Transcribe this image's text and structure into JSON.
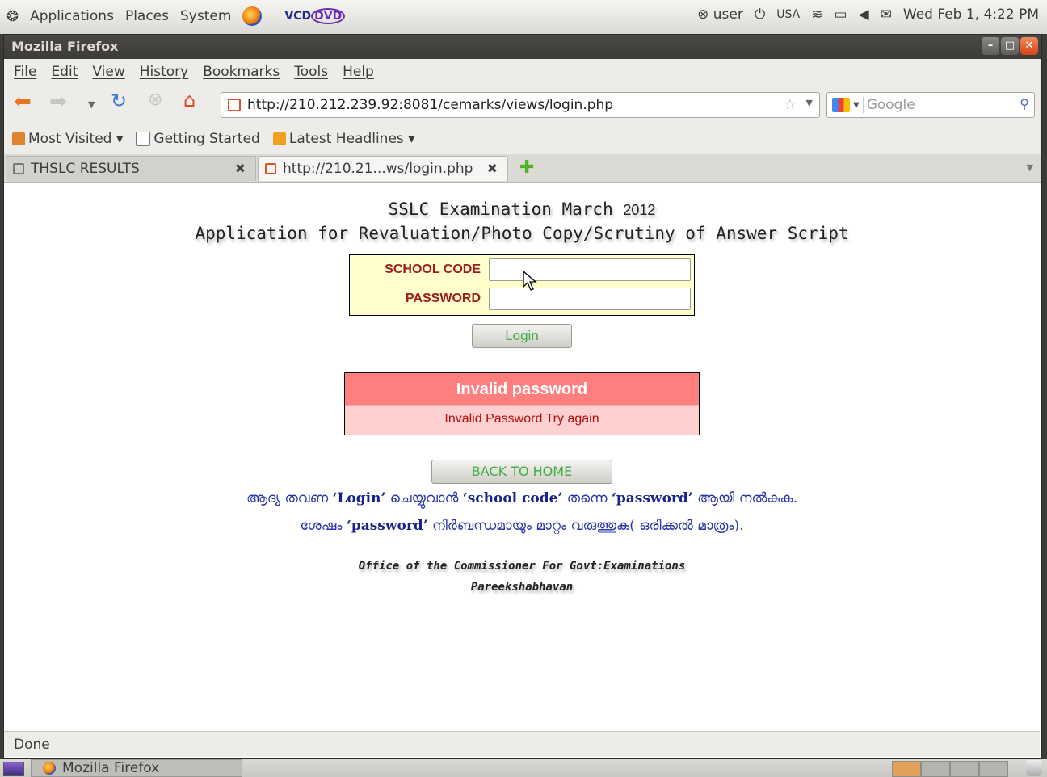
{
  "top_panel": {
    "menus": [
      "Applications",
      "Places",
      "System"
    ],
    "user": "user",
    "keyboard": "USA",
    "datetime": "Wed Feb 1, 4:22 PM",
    "vcd_label": "VCD",
    "dvd_label": "DVD"
  },
  "window": {
    "title": "Mozilla Firefox"
  },
  "menubar": [
    "File",
    "Edit",
    "View",
    "History",
    "Bookmarks",
    "Tools",
    "Help"
  ],
  "navbar": {
    "url": "http://210.212.239.92:8081/cemarks/views/login.php",
    "search_placeholder": "Google"
  },
  "bookmarks": [
    {
      "label": "Most Visited ▾",
      "icon": "folder-icon"
    },
    {
      "label": "Getting Started",
      "icon": "page-icon"
    },
    {
      "label": "Latest Headlines ▾",
      "icon": "rss-icon"
    }
  ],
  "tabs": [
    {
      "label": "THSLC RESULTS",
      "active": false
    },
    {
      "label": "http://210.21...ws/login.php",
      "active": true
    }
  ],
  "page": {
    "heading1": "SSLC Examination March",
    "heading1_year": "2012",
    "heading2": "Application for Revaluation/Photo Copy/Scrutiny of Answer Script",
    "school_code_label": "SCHOOL CODE",
    "password_label": "PASSWORD",
    "school_code_value": "",
    "password_value": "",
    "login_button": "Login",
    "error_title": "Invalid password",
    "error_message": "Invalid Password Try again",
    "home_button": "BACK TO HOME",
    "note_line1": {
      "p1": "ആദ്യ തവണ ",
      "b1": "‘Login’",
      "p2": " ചെയ്യുവാൻ ",
      "b2": "‘school code’",
      "p3": " തന്നെ ",
      "b3": "‘password’",
      "p4": " ആയി നൽകുക."
    },
    "note_line2": {
      "p1": "ശേഷം ",
      "b1": "‘password’",
      "p2": " നിർബന്ധമായും മാറ്റം വരുത്തുക( ഒരിക്കൽ മാത്രം)."
    },
    "office_line1": "Office of the Commissioner For Govt:Examinations",
    "office_line2": "Pareekshabhavan"
  },
  "statusbar": {
    "text": "Done"
  },
  "taskbar": {
    "item": "Mozilla Firefox"
  }
}
